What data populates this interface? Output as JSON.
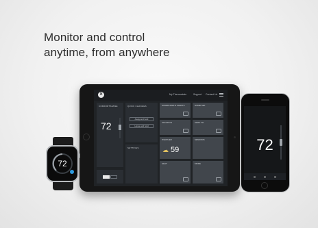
{
  "headline": {
    "line1": "Monitor and control",
    "line2": "anytime, from anywhere"
  },
  "tablet": {
    "nav": [
      "My Thermostats",
      "Support",
      "Contact Us"
    ],
    "thermostat_panel": {
      "title": "COMFORTSENSE",
      "temperature": "72"
    },
    "quick_changes": {
      "title": "QUICK CHANGES",
      "buttons": [
        "Away and hold",
        "Home and hold"
      ]
    },
    "settings_label": "SETTINGS",
    "weather_temperature": "59",
    "tiles": [
      "SCHEDULES & ALERTS",
      "HOME SET",
      "VACATION",
      "AWAY TO",
      "WEATHER",
      "SENSORS",
      "HEAT",
      "MODE"
    ]
  },
  "watch": {
    "temperature": "72"
  },
  "phone": {
    "temperature": "72"
  },
  "colors": {
    "accent": "#2d9be0",
    "device_dark": "#161616",
    "tile": "#41464c"
  }
}
